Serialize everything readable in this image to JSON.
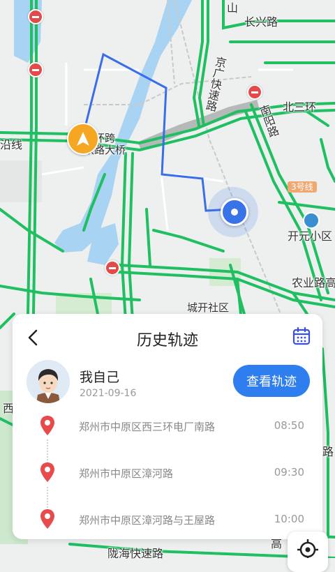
{
  "map": {
    "labels": {
      "changxing": "长兴路",
      "shan": "山",
      "jinggang": "京广快速路",
      "beisanhuan": "北三环",
      "nanyang": "南阳路",
      "sanhuanqiao": "三环跨\n铁路大桥",
      "yanxian": "沿线",
      "line3": "3号线",
      "kaiyuan": "开元小区",
      "nongye": "农业路高",
      "chengkai": "城开社区",
      "longhai": "陇海快速路",
      "left_edge": "西",
      "right_edge": "路",
      "gao": "高"
    },
    "colors": {
      "road": "#1fbf62",
      "track": "#3a6ee8",
      "rail": "#c8c8c8"
    }
  },
  "sheet": {
    "title": "历史轨迹",
    "back_icon": "chevron-left-icon",
    "calendar_icon": "calendar-icon",
    "user": {
      "name": "我自己",
      "date": "2021-09-16"
    },
    "view_button": "查看轨迹",
    "records": [
      {
        "address": "郑州市中原区西三环电厂南路",
        "time": "08:50"
      },
      {
        "address": "郑州市中原区漳河路",
        "time": "09:30"
      },
      {
        "address": "郑州市中原区漳河路与王屋路",
        "time": "10:00"
      }
    ]
  },
  "controls": {
    "locate_icon": "crosshair-icon"
  },
  "colors": {
    "accent": "#2f7ef0",
    "pin": "#e84b4b",
    "nav": "#f5a623"
  }
}
